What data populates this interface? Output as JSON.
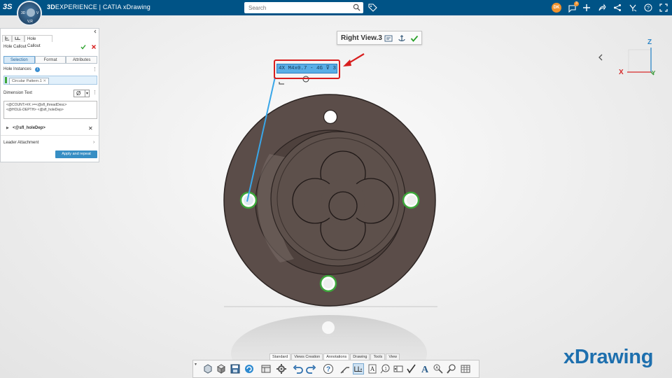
{
  "topbar": {
    "brand_bold": "3D",
    "brand_rest": "EXPERIENCE | CATIA  xDrawing",
    "search_placeholder": "Search",
    "user_initials": "DK",
    "notif_count": "3",
    "compass_labels": {
      "left": "3D",
      "right": "V",
      "bottom": "V,R"
    },
    "colors": {
      "bar": "#005386",
      "accent": "#f0922d"
    }
  },
  "panel": {
    "tab_label": "Hole Callout",
    "title": "Hole Callout",
    "segments": [
      "Selection",
      "Format",
      "Attributes"
    ],
    "active_segment": "Selection",
    "hole_instances_label": "Hole Instances",
    "chip_label": "Circular Pattern.1",
    "dimension_text_label": "Dimension Text",
    "diameter_symbol": "Ø",
    "dimension_text_lines": [
      "<@COUNT>#X >=<@sfl_threadDesc>",
      "<@HOLE-DEPTH> <@sfl_holeDep>"
    ],
    "attr_row_label": "<@sfl_holeDep>",
    "leader_attachment_label": "Leader Attachment",
    "apply_button": "Apply and repeat"
  },
  "view_label": {
    "title": "Right View.3"
  },
  "callout": {
    "text": "4X M4x0.7 - 4G ⊽ 3"
  },
  "axes": {
    "x": "X",
    "y": "Y",
    "z": "Z"
  },
  "action_bar": {
    "tabs": [
      "Standard",
      "Views Creation",
      "Annotations",
      "Drawing",
      "Tools",
      "View"
    ],
    "active_tab": "Annotations"
  },
  "watermark": "xDrawing"
}
